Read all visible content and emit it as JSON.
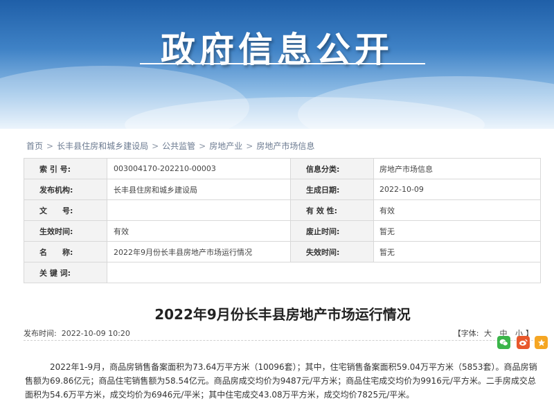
{
  "banner": {
    "title": "政府信息公开"
  },
  "breadcrumb": [
    "首页",
    "长丰县住房和城乡建设局",
    "公共监管",
    "房地产业",
    "房地产市场信息"
  ],
  "meta": {
    "rows": [
      {
        "l1": "索 引 号:",
        "v1": "003004170-202210-00003",
        "l2": "信息分类:",
        "v2": "房地产市场信息"
      },
      {
        "l1": "发布机构:",
        "v1": "长丰县住房和城乡建设局",
        "l2": "生成日期:",
        "v2": "2022-10-09"
      },
      {
        "l1": "文　　号:",
        "v1": "",
        "l2": "有 效 性:",
        "v2": "有效"
      },
      {
        "l1": "生效时间:",
        "v1": "有效",
        "l2": "废止时间:",
        "v2": "暂无"
      },
      {
        "l1": "名　　称:",
        "v1": "2022年9月份长丰县房地产市场运行情况",
        "l2": "失效时间:",
        "v2": "暂无"
      },
      {
        "l1": "关 键 词:",
        "v1": ""
      }
    ]
  },
  "article": {
    "title": "2022年9月份长丰县房地产市场运行情况",
    "publish_label": "发布时间:",
    "publish_time": "2022-10-09 10:20",
    "font_label": "【字体:",
    "font_large": "大",
    "font_medium": "中",
    "font_small": "小",
    "font_close": "】",
    "body": "2022年1-9月，商品房销售备案面积为73.64万平方米（10096套）；其中，住宅销售备案面积59.04万平方米（5853套）。商品房销售额为69.86亿元；商品住宅销售额为58.54亿元。商品房成交均价为9487元/平方米；商品住宅成交均价为9916元/平方米。二手房成交总面积为54.6万平方米，成交均价为6946元/平米；其中住宅成交43.08万平方米，成交均价7825元/平米。"
  },
  "share_icons": [
    "wechat-icon",
    "weibo-icon",
    "favorite-icon"
  ]
}
